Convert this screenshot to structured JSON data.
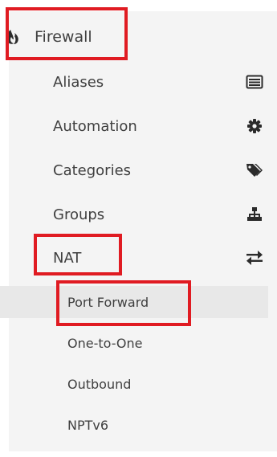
{
  "menu": {
    "section": {
      "label": "Firewall",
      "icon": "fire-icon"
    },
    "items": [
      {
        "label": "Aliases",
        "icon": "list-icon"
      },
      {
        "label": "Automation",
        "icon": "gear-icon"
      },
      {
        "label": "Categories",
        "icon": "tags-icon"
      },
      {
        "label": "Groups",
        "icon": "sitemap-icon"
      },
      {
        "label": "NAT",
        "icon": "exchange-icon"
      }
    ],
    "nat_subitems": [
      {
        "label": "Port Forward",
        "active": true
      },
      {
        "label": "One-to-One"
      },
      {
        "label": "Outbound"
      },
      {
        "label": "NPTv6"
      }
    ]
  },
  "colors": {
    "highlight": "#e01b22",
    "panel_bg": "#f4f4f4",
    "active_bg": "#e8e8e8",
    "text": "#3f3f3f"
  }
}
